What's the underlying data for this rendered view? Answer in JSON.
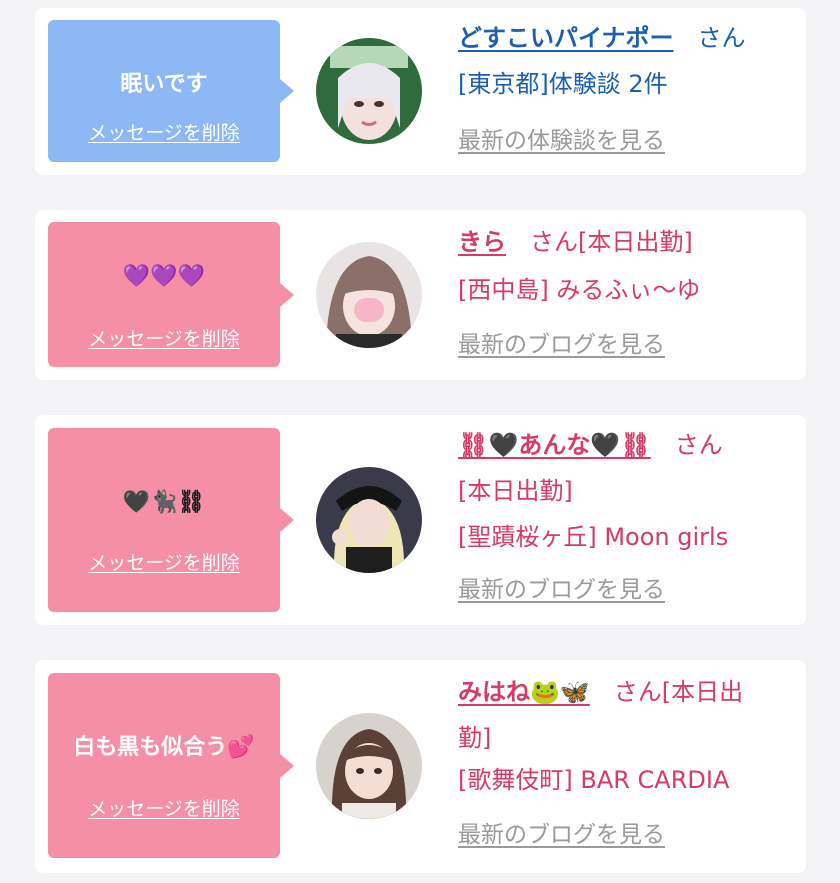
{
  "delete_label": "メッセージを削除",
  "honorific": "さん",
  "cards": [
    {
      "message": "眠いです",
      "name": "どすこいパイナポー",
      "line2": "[東京都]体験談 2件",
      "link": "最新の体験談を見る"
    },
    {
      "message": "💜💜💜",
      "name": "きら",
      "status": "[本日出勤]",
      "line2": "[西中島] みるふぃ〜ゆ",
      "link": "最新のブログを見る"
    },
    {
      "message": "🖤🐈‍⬛⛓",
      "name": "⛓🖤あんな🖤⛓",
      "status": "[本日出勤]",
      "line3": "[聖蹟桜ヶ丘] Moon girls",
      "link": "最新のブログを見る"
    },
    {
      "message": "白も黒も似合う💕",
      "name": "みはね🐸🦋",
      "status_a": "[本日出",
      "status_b": "勤]",
      "line3": "[歌舞伎町] BAR CARDIA",
      "link": "最新のブログを見る"
    }
  ],
  "colors": {
    "blue_bubble": "#8db7f5",
    "pink_bubble": "#f48fa6",
    "blue_text": "#1b5fb0",
    "pink_text": "#d83a66"
  }
}
